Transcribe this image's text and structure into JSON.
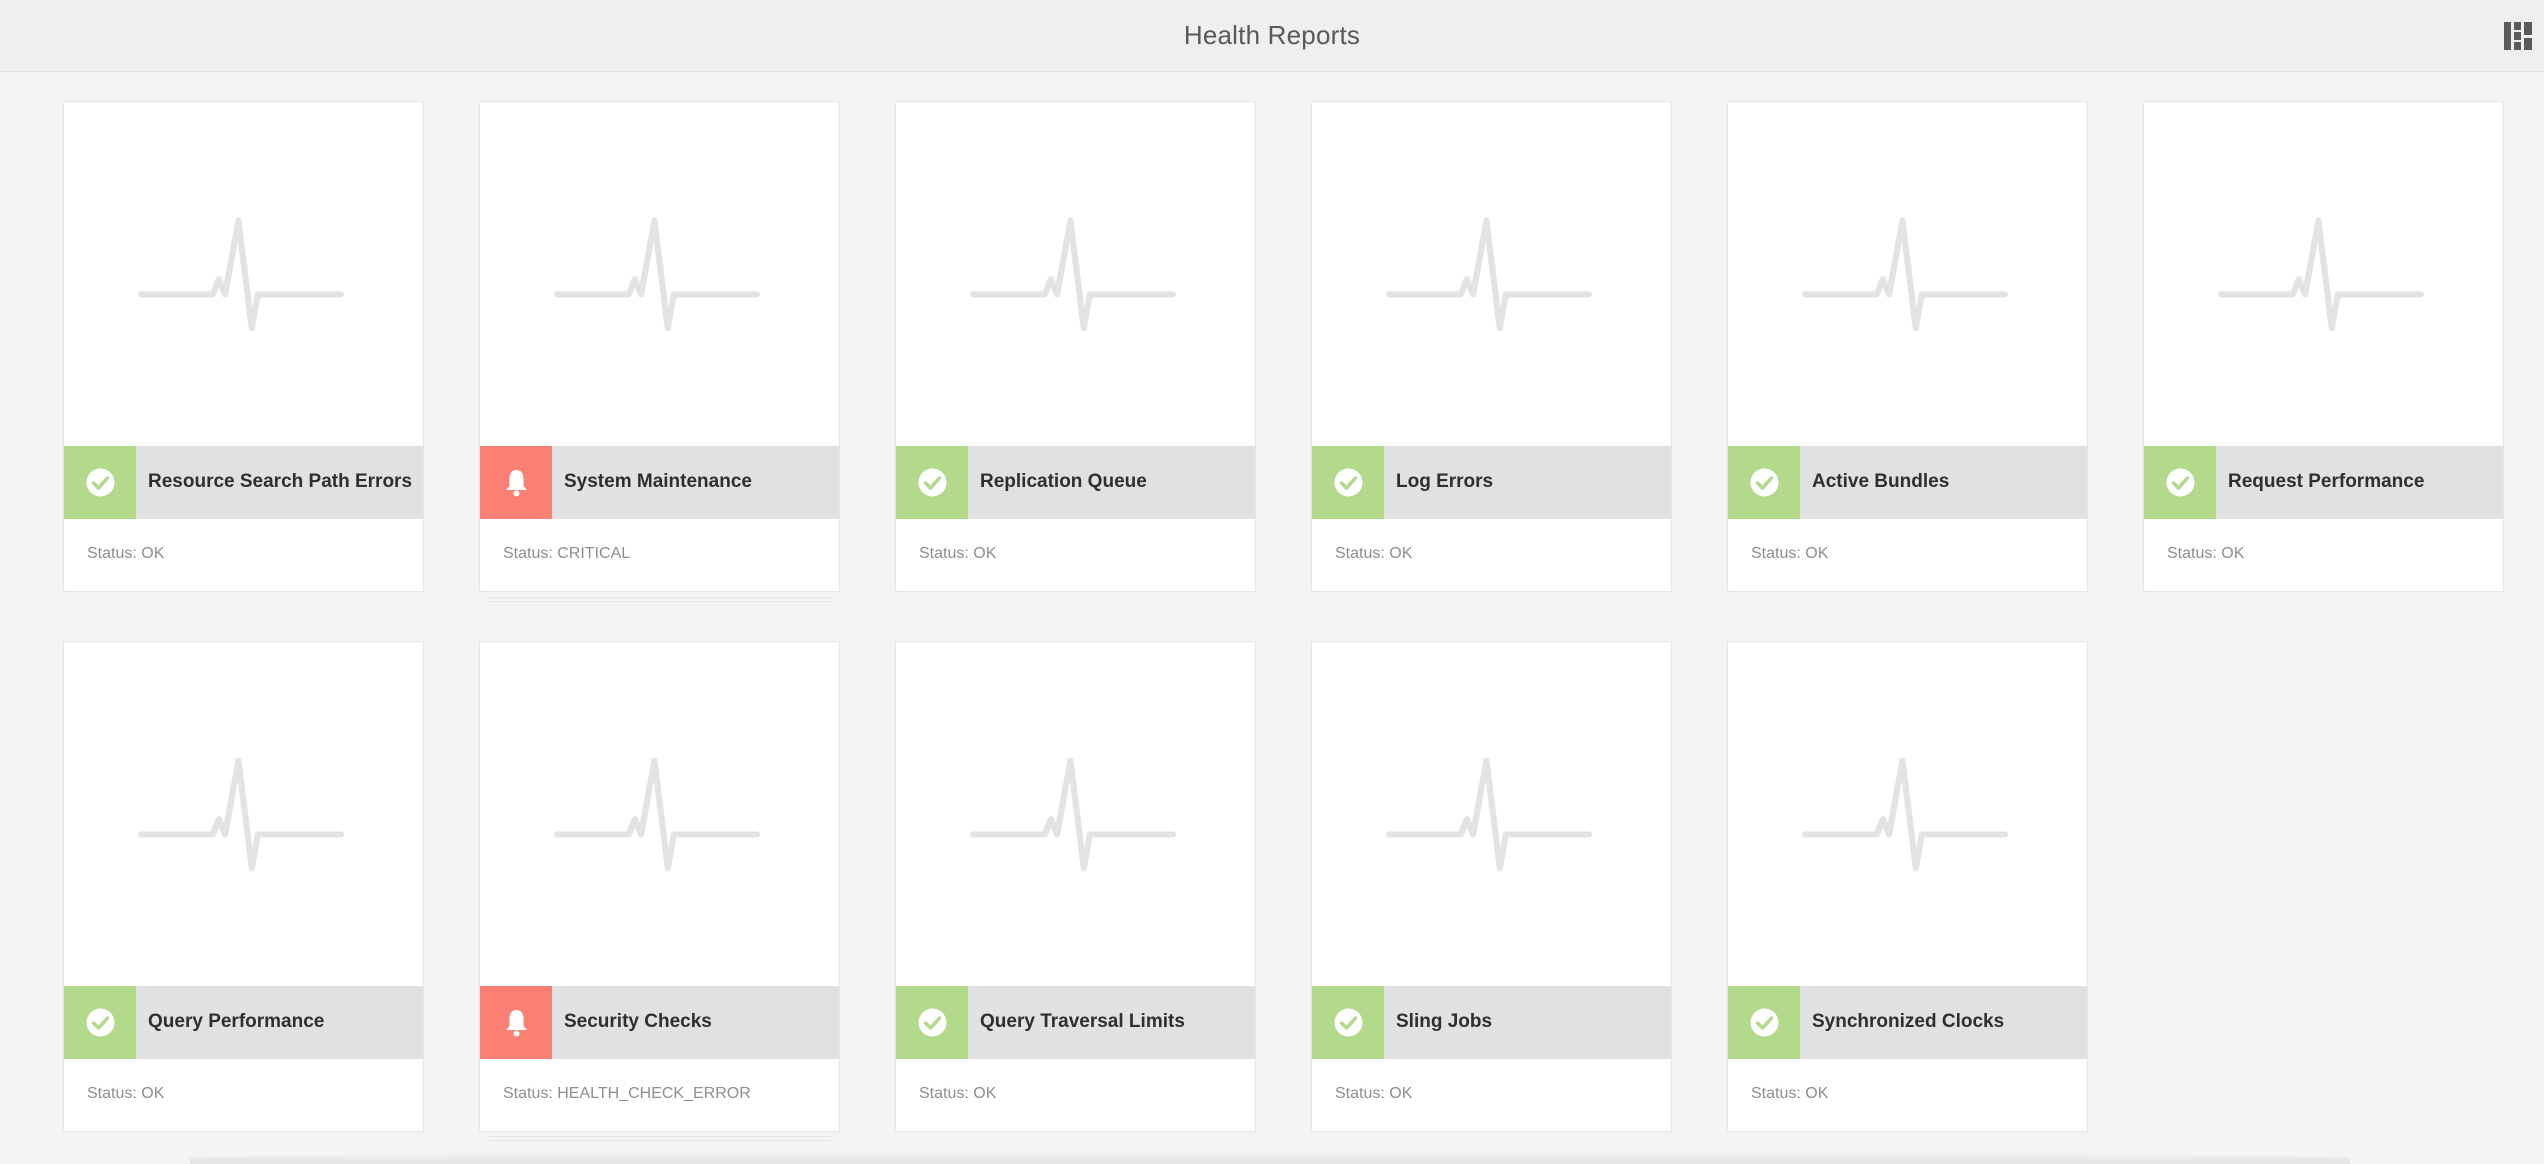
{
  "header": {
    "title": "Health Reports",
    "view_toggle_icon": "card-view-icon"
  },
  "colors": {
    "ok": "#b3d98a",
    "critical": "#fa8073",
    "title_bar": "#e1e1e1",
    "pulse": "#e3e3e3"
  },
  "cards": [
    {
      "title": "Resource Search Path Errors",
      "status_text": "Status: OK",
      "state": "ok",
      "icon": "check-icon"
    },
    {
      "title": "System Maintenance",
      "status_text": "Status: CRITICAL",
      "state": "critical",
      "icon": "bell-icon"
    },
    {
      "title": "Replication Queue",
      "status_text": "Status: OK",
      "state": "ok",
      "icon": "check-icon"
    },
    {
      "title": "Log Errors",
      "status_text": "Status: OK",
      "state": "ok",
      "icon": "check-icon"
    },
    {
      "title": "Active Bundles",
      "status_text": "Status: OK",
      "state": "ok",
      "icon": "check-icon"
    },
    {
      "title": "Request Performance",
      "status_text": "Status: OK",
      "state": "ok",
      "icon": "check-icon"
    },
    {
      "title": "Query Performance",
      "status_text": "Status: OK",
      "state": "ok",
      "icon": "check-icon"
    },
    {
      "title": "Security Checks",
      "status_text": "Status: HEALTH_CHECK_ERROR",
      "state": "critical",
      "icon": "bell-icon"
    },
    {
      "title": "Query Traversal Limits",
      "status_text": "Status: OK",
      "state": "ok",
      "icon": "check-icon"
    },
    {
      "title": "Sling Jobs",
      "status_text": "Status: OK",
      "state": "ok",
      "icon": "check-icon"
    },
    {
      "title": "Synchronized Clocks",
      "status_text": "Status: OK",
      "state": "ok",
      "icon": "check-icon"
    }
  ]
}
